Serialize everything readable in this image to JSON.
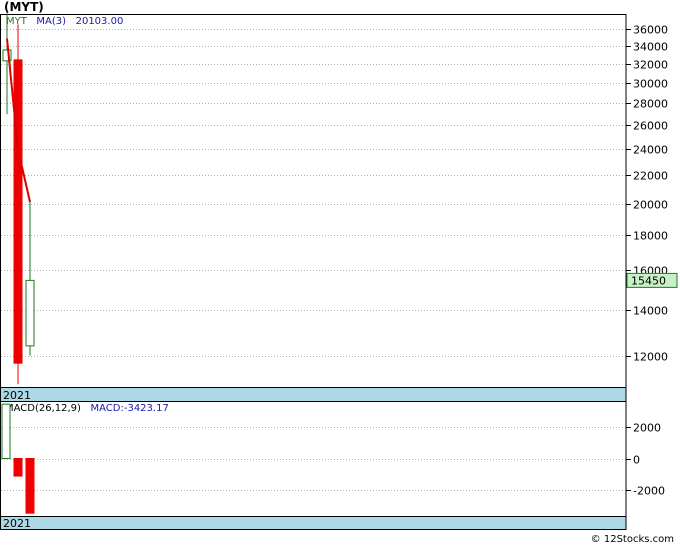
{
  "title": "(MYT)",
  "legend": {
    "symbol": "MYT",
    "ma_label": "MA(3)",
    "ma_value": "20103.00"
  },
  "macd_legend": {
    "params": "MACD(26,12,9)",
    "value": "MACD:-3423.17"
  },
  "footer": "© 12Stocks.com",
  "colors": {
    "up": "#1f7a1f",
    "down": "#ee0000",
    "ma": "#dd0000",
    "axis_band": "#add8e6",
    "price_tag": "#c8f0c8"
  },
  "chart_data": [
    {
      "type": "candlestick",
      "x_label": "2021",
      "ylim": [
        10800,
        37800
      ],
      "yscale": "log",
      "yticks": [
        12000,
        14000,
        16000,
        18000,
        20000,
        22000,
        24000,
        26000,
        28000,
        30000,
        32000,
        34000,
        36000
      ],
      "last_price": 15450,
      "candles": [
        {
          "open": 32300,
          "close": 33500,
          "high": 38000,
          "low": 27000
        },
        {
          "open": 32400,
          "close": 11700,
          "high": 36500,
          "low": 10900
        },
        {
          "open": 12400,
          "close": 15450,
          "high": 20100,
          "low": 12000
        }
      ],
      "ma": {
        "name": "MA(3)",
        "values": [
          34800,
          24000,
          20103
        ]
      }
    },
    {
      "type": "bar",
      "x_label": "2021",
      "ylim": [
        -3600,
        3600
      ],
      "yticks": [
        2000,
        0,
        -2000
      ],
      "values": [
        3400,
        -1100,
        -3423.17
      ]
    }
  ]
}
